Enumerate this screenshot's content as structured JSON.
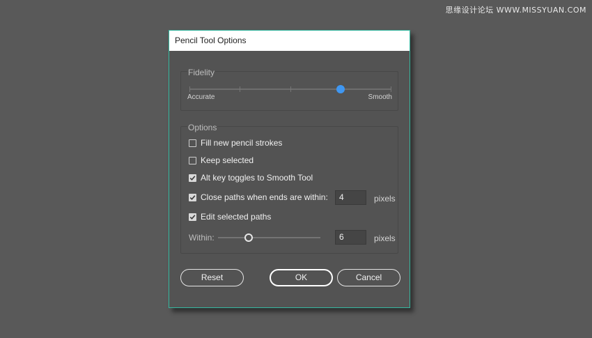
{
  "watermark": "思缘设计论坛 WWW.MISSYUAN.COM",
  "dialog": {
    "title": "Pencil Tool Options",
    "fidelity": {
      "title": "Fidelity",
      "min_label": "Accurate",
      "max_label": "Smooth",
      "value_fraction": 0.75,
      "accent_color": "#3f97f2"
    },
    "options": {
      "title": "Options",
      "fill_new_pencil_strokes": {
        "label": "Fill new pencil strokes",
        "checked": false
      },
      "keep_selected": {
        "label": "Keep selected",
        "checked": false
      },
      "alt_key_toggles": {
        "label": "Alt key toggles to Smooth Tool",
        "checked": true
      },
      "close_paths": {
        "label": "Close paths when ends are within:",
        "checked": true,
        "value": "4",
        "unit": "pixels"
      },
      "edit_selected_paths": {
        "label": "Edit selected paths",
        "checked": true
      },
      "within": {
        "label": "Within:",
        "value": "6",
        "unit": "pixels",
        "slider_fraction": 0.3
      }
    },
    "buttons": {
      "reset": "Reset",
      "ok": "OK",
      "cancel": "Cancel"
    },
    "border_color": "#35b8a0"
  }
}
